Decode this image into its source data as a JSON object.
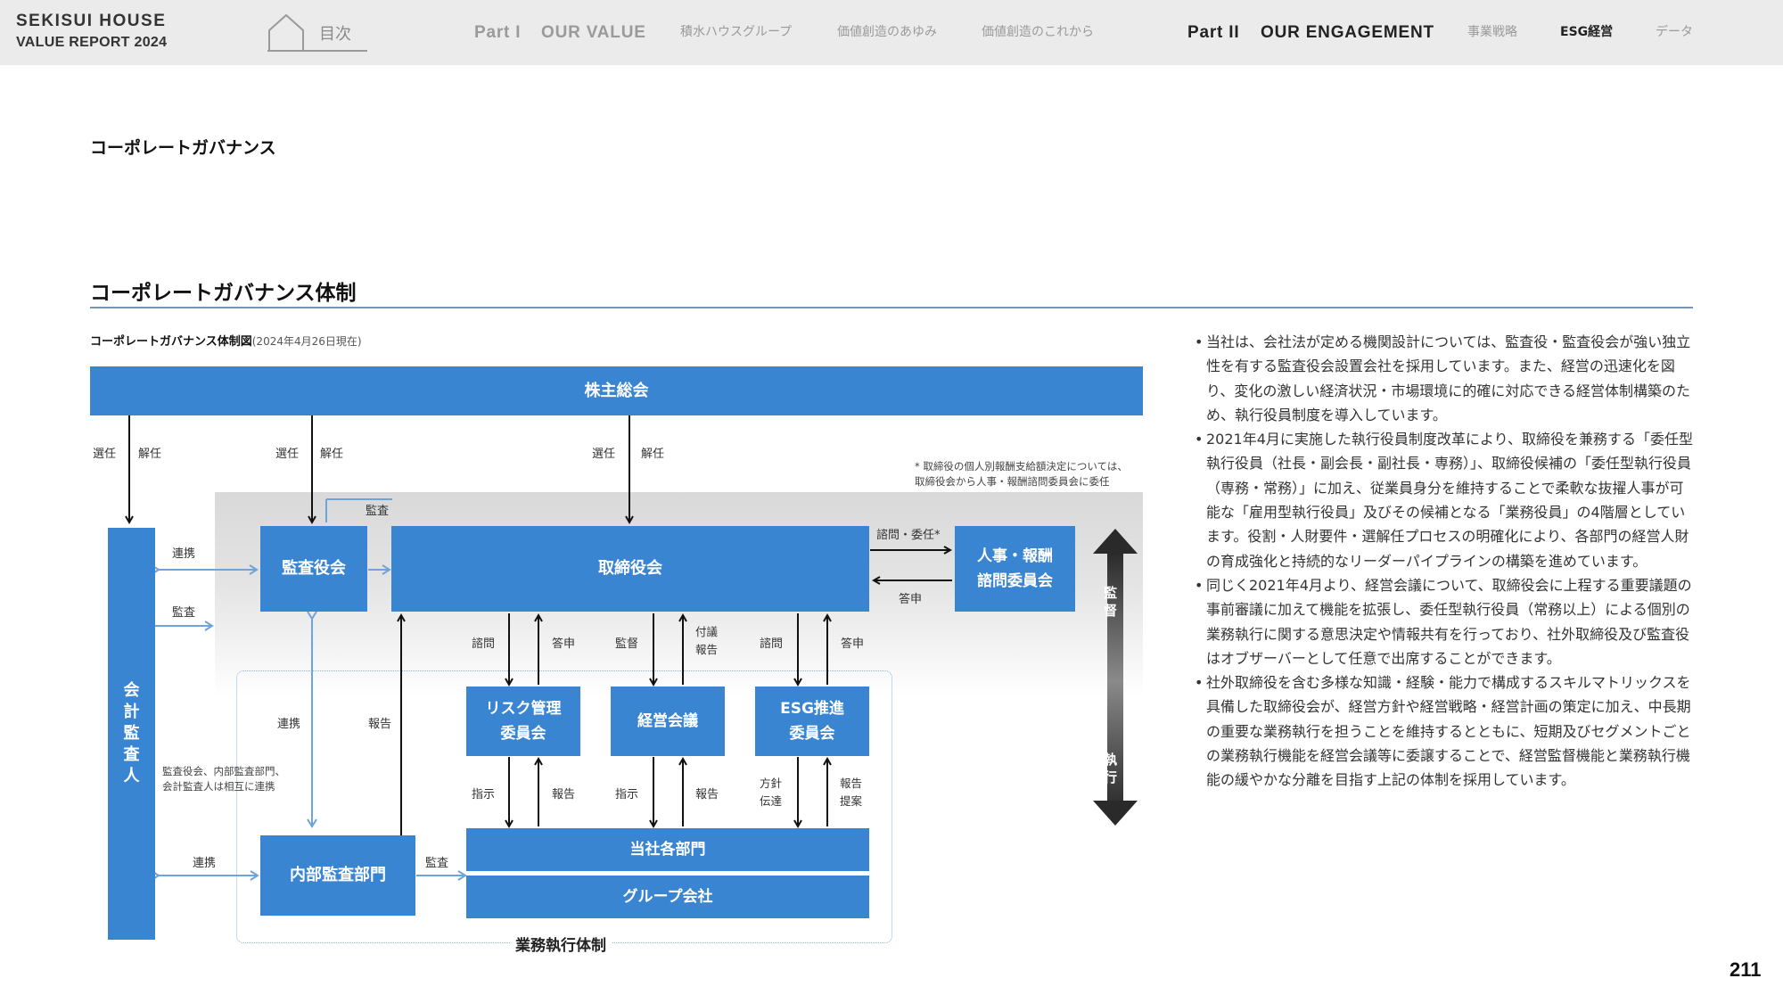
{
  "header": {
    "brand_line1": "SEKISUI HOUSE",
    "brand_line2": "VALUE REPORT 2024",
    "toc_label": "目次",
    "part1_num": "Part I",
    "part1_title": "OUR VALUE",
    "part1_items": [
      "積水ハウスグループ",
      "価値創造のあゆみ",
      "価値創造のこれから"
    ],
    "part2_num": "Part II",
    "part2_title": "OUR ENGAGEMENT",
    "part2_items": [
      "事業戦略",
      "ESG経営",
      "データ"
    ]
  },
  "page": {
    "section_title": "コーポレートガバナンス",
    "heading": "コーポレートガバナンス体制",
    "diagram_title": "コーポレートガバナンス体制図",
    "diagram_date": "(2024年4月26日現在)",
    "page_number": "211"
  },
  "diagram": {
    "shareholders": "株主総会",
    "auditor_board": "監査役会",
    "board": "取締役会",
    "nomination": "人事・報酬\n諮問委員会",
    "accounting_auditor": "会計監査人",
    "risk": "リスク管理\n委員会",
    "mgmt_meeting": "経営会議",
    "esg": "ESG推進\n委員会",
    "internal_audit": "内部監査部門",
    "departments": "当社各部門",
    "group": "グループ会社",
    "exec_system": "業務執行体制",
    "supervise": "監督",
    "execute": "執行",
    "elect": "選任",
    "dismiss": "解任",
    "audit": "監査",
    "cooperate": "連携",
    "report": "報告",
    "consult": "諮問",
    "reply": "答申",
    "supervision": "監督",
    "refer_report": "付議\n報告",
    "instruct": "指示",
    "policy": "方針\n伝達",
    "report_propose": "報告\n提案",
    "consult_delegate": "諮問・委任*",
    "note": "* 取締役の個人別報酬支給額決定については、\n取締役会から人事・報酬諮問委員会に委任",
    "mutual_note": "監査役会、内部監査部門、\n会計監査人は相互に連携"
  },
  "bullets": [
    "当社は、会社法が定める機関設計については、監査役・監査役会が強い独立性を有する監査役会設置会社を採用しています。また、経営の迅速化を図り、変化の激しい経済状況・市場環境に的確に対応できる経営体制構築のため、執行役員制度を導入しています。",
    "2021年4月に実施した執行役員制度改革により、取締役を兼務する「委任型執行役員（社長・副会長・副社長・専務）」、取締役候補の「委任型執行役員（専務・常務）」に加え、従業員身分を維持することで柔軟な抜擢人事が可能な「雇用型執行役員」及びその候補となる「業務役員」の4階層としています。役割・人財要件・選解任プロセスの明確化により、各部門の経営人財の育成強化と持続的なリーダーパイプラインの構築を進めています。",
    "同じく2021年4月より、経営会議について、取締役会に上程する重要議題の事前審議に加えて機能を拡張し、委任型執行役員（常務以上）による個別の業務執行に関する意思決定や情報共有を行っており、社外取締役及び監査役はオブザーバーとして任意で出席することができます。",
    "社外取締役を含む多様な知識・経験・能力で構成するスキルマトリックスを具備した取締役会が、経営方針や経営戦略・経営計画の策定に加え、中長期の重要な業務執行を担うことを維持するとともに、短期及びセグメントごとの業務執行機能を経営会議等に委譲することで、経営監督機能と業務執行機能の緩やかな分離を目指す上記の体制を採用しています。"
  ],
  "colors": {
    "box_blue": "#3985d2",
    "light_arrow": "#6fa3dc",
    "header_bg": "#ebebeb",
    "rule": "#7b93b3"
  }
}
